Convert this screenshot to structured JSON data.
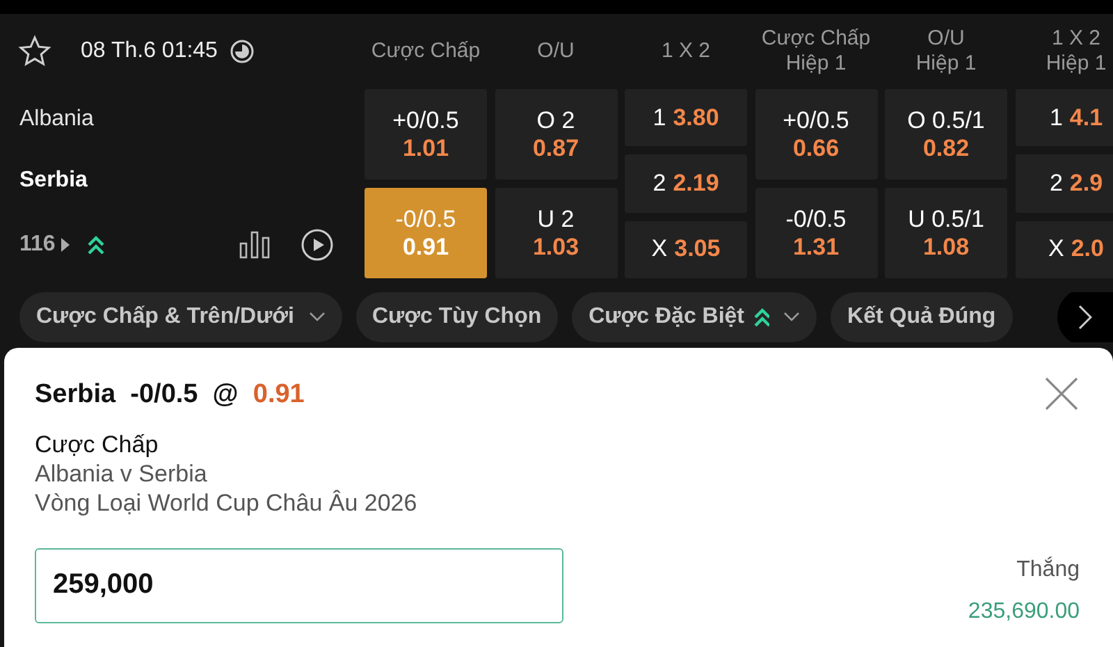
{
  "match": {
    "favorite": false,
    "date_time": "08 Th.6 01:45",
    "teams": [
      "Albania",
      "Serbia"
    ],
    "market_count": "116",
    "trending": true
  },
  "columns": [
    {
      "kind": "line",
      "header": [
        "Cược Chấp"
      ],
      "cells": [
        {
          "label": "+0/0.5",
          "odds": "1.01",
          "selected": false
        },
        {
          "label": "-0/0.5",
          "odds": "0.91",
          "selected": true
        }
      ]
    },
    {
      "kind": "line",
      "header": [
        "O/U"
      ],
      "cells": [
        {
          "label": "O 2",
          "odds": "0.87",
          "selected": false
        },
        {
          "label": "U 2",
          "odds": "1.03",
          "selected": false
        }
      ]
    },
    {
      "kind": "result",
      "header": [
        "1 X 2"
      ],
      "cells": [
        {
          "label": "1",
          "odds": "3.80",
          "selected": false
        },
        {
          "label": "2",
          "odds": "2.19",
          "selected": false
        },
        {
          "label": "X",
          "odds": "3.05",
          "selected": false
        }
      ]
    },
    {
      "kind": "line",
      "header": [
        "Cược Chấp",
        "Hiệp 1"
      ],
      "cells": [
        {
          "label": "+0/0.5",
          "odds": "0.66",
          "selected": false
        },
        {
          "label": "-0/0.5",
          "odds": "1.31",
          "selected": false
        }
      ]
    },
    {
      "kind": "line",
      "header": [
        "O/U",
        "Hiệp 1"
      ],
      "cells": [
        {
          "label": "O 0.5/1",
          "odds": "0.82",
          "selected": false
        },
        {
          "label": "U 0.5/1",
          "odds": "1.08",
          "selected": false
        }
      ]
    },
    {
      "kind": "result",
      "header": [
        "1 X 2",
        "Hiệp 1"
      ],
      "cells": [
        {
          "label": "1",
          "odds": "4.1",
          "selected": false
        },
        {
          "label": "2",
          "odds": "2.9",
          "selected": false
        },
        {
          "label": "X",
          "odds": "2.0",
          "selected": false
        }
      ]
    }
  ],
  "tabs": [
    {
      "label": "Cược Chấp & Trên/Dưới",
      "trending": false,
      "dropdown": true
    },
    {
      "label": "Cược Tùy Chọn",
      "trending": false,
      "dropdown": false
    },
    {
      "label": "Cược Đặc Biệt",
      "trending": true,
      "dropdown": true
    },
    {
      "label": "Kết Quả Đúng",
      "trending": false,
      "dropdown": false
    }
  ],
  "bet_slip": {
    "selection": "Serbia",
    "line": "-0/0.5",
    "at": "@",
    "odds": "0.91",
    "market": "Cược Chấp",
    "event": "Albania v Serbia",
    "competition": "Vòng Loại World Cup Châu Âu 2026",
    "stake": "259,000",
    "win_label": "Thắng",
    "win_amount": "235,690.00"
  }
}
